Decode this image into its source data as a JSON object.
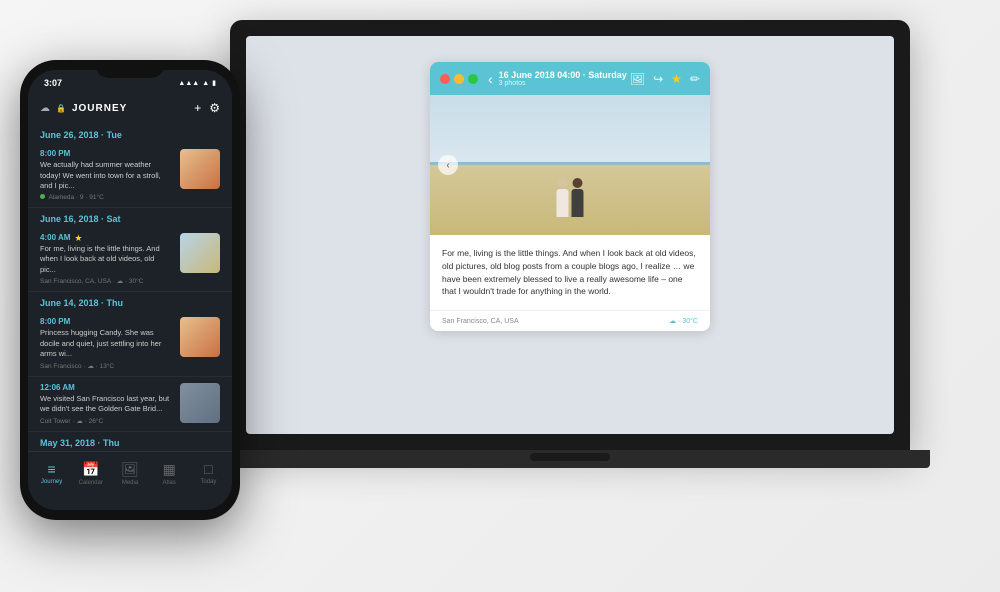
{
  "app": {
    "name": "Journey",
    "title_display": "JouRNey"
  },
  "phone": {
    "status_time": "3:07",
    "header_title": "JOURNEY",
    "entries": [
      {
        "date_header": "June 26, 2018 · Tue",
        "time": "8:00 PM",
        "preview": "We actually had summer weather today! We went into town for a stroll, and I pic...",
        "meta": "Alameda · 9 · 91°C",
        "thumb_type": "family",
        "starred": false
      },
      {
        "date_header": "June 16, 2018 · Sat",
        "time": "4:00 AM",
        "preview": "For me, living is the little things. And when I look back at old videos, old pic...",
        "meta": "San Francisco, CA, USA · ☁ · 30°C",
        "thumb_type": "beach",
        "starred": true
      },
      {
        "date_header": "June 14, 2018 · Thu",
        "time": "8:00 PM",
        "preview": "Princess hugging Candy. She was docile and quiet, just settling into her arms wi...",
        "meta": "San Francisco · ☁ · 13°C",
        "thumb_type": "family",
        "starred": false
      },
      {
        "date_header": "",
        "time": "12:06 AM",
        "preview": "We visited San Francisco last year, but we didn't see the Golden Gate Brid...",
        "meta": "Coit Tower · ☁ · 26°C",
        "thumb_type": "city",
        "starred": false
      }
    ],
    "last_date_header": "May 31, 2018 · Thu",
    "bottom_nav": [
      {
        "label": "Journey",
        "active": true
      },
      {
        "label": "Calendar",
        "active": false
      },
      {
        "label": "Media",
        "active": false
      },
      {
        "label": "Atlas",
        "active": false
      },
      {
        "label": "Today",
        "active": false
      }
    ]
  },
  "journal_card": {
    "date": "16 June 2018 04:00 · Saturday",
    "photo_count": "3 photos",
    "text": "For me, living is the little things. And when I look back at old videos, old pictures, old blog posts from a couple blogs ago, I realize … we have been extremely blessed to live a really awesome life – one that I wouldn't trade for anything in the world.",
    "location": "San Francisco, CA, USA",
    "weather": "☁ · 30°C"
  },
  "colors": {
    "teal": "#5bc4d4",
    "dark_bg": "#1c2228",
    "text_light": "#cccccc",
    "star": "#ffd700"
  }
}
